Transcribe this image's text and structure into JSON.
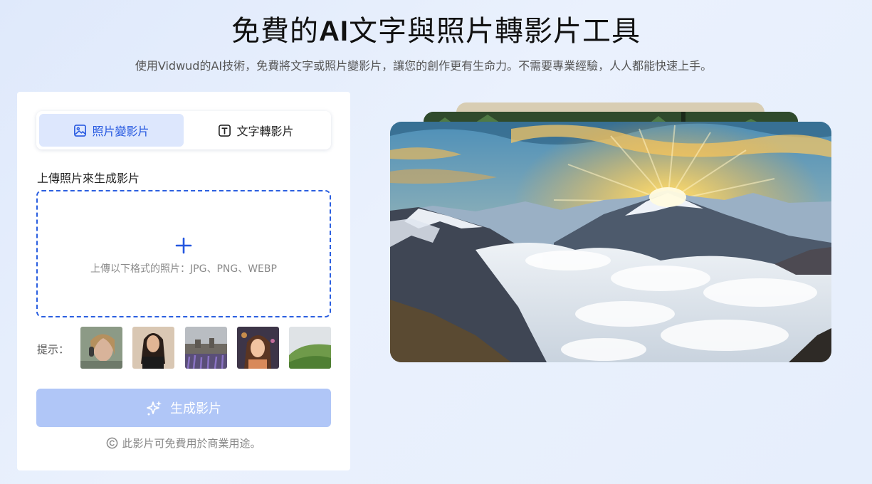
{
  "header": {
    "title_prefix": "免費的",
    "title_ai": "AI",
    "title_suffix": "文字與照片轉影片工具",
    "subtitle": "使用Vidwud的AI技術，免費將文字或照片變影片，讓您的創作更有生命力。不需要專業經驗，人人都能快速上手。"
  },
  "tabs": [
    {
      "label": "照片變影片",
      "icon": "image-icon",
      "active": true
    },
    {
      "label": "文字轉影片",
      "icon": "text-icon",
      "active": false
    }
  ],
  "upload": {
    "label": "上傳照片來生成影片",
    "hint": "上傳以下格式的照片：JPG、PNG、WEBP"
  },
  "tips": {
    "label": "提示：",
    "samples": [
      "woman-headphones-thumbnail",
      "woman-dark-hair-thumbnail",
      "castle-lavender-thumbnail",
      "anime-girl-thumbnail",
      "green-hill-thumbnail"
    ]
  },
  "generate": {
    "label": "生成影片",
    "icon": "sparkle-icon"
  },
  "license": {
    "note": "此影片可免費用於商業用途。",
    "icon": "copyright-icon"
  },
  "hero": {
    "image": "mountain-sunrise-above-clouds"
  },
  "colors": {
    "accent": "#2457e0",
    "button_disabled": "#b0c6f7",
    "tab_active_bg": "#dde7fd"
  }
}
